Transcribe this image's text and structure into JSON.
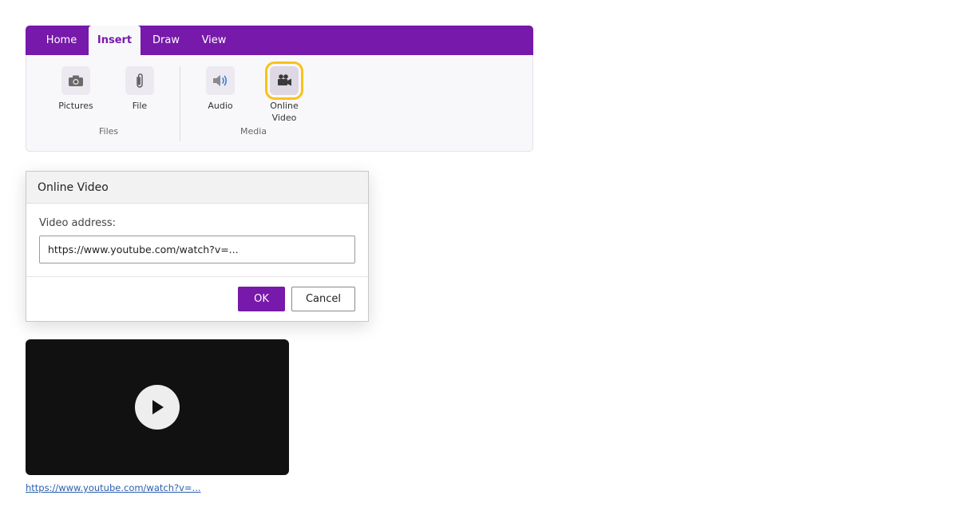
{
  "ribbon": {
    "tabs": [
      {
        "label": "Home",
        "active": false
      },
      {
        "label": "Insert",
        "active": true
      },
      {
        "label": "Draw",
        "active": false
      },
      {
        "label": "View",
        "active": false
      }
    ],
    "groups": [
      {
        "label": "Files",
        "buttons": [
          {
            "label": "Pictures",
            "icon": "camera-icon"
          },
          {
            "label": "File",
            "icon": "paperclip-icon"
          }
        ]
      },
      {
        "label": "Media",
        "buttons": [
          {
            "label": "Audio",
            "icon": "speaker-icon"
          },
          {
            "label": "Online Video",
            "icon": "video-camera-icon",
            "selected": true
          }
        ]
      }
    ],
    "highlight_color": "#f8c21a"
  },
  "dialog": {
    "title": "Online Video",
    "field_label": "Video address:",
    "field_value": "https://www.youtube.com/watch?v=...",
    "ok_label": "OK",
    "cancel_label": "Cancel"
  },
  "video": {
    "play_icon": "play-icon",
    "link_text": "https://www.youtube.com/watch?v=..."
  },
  "colors": {
    "accent": "#7719aa",
    "link": "#2a5fad"
  }
}
